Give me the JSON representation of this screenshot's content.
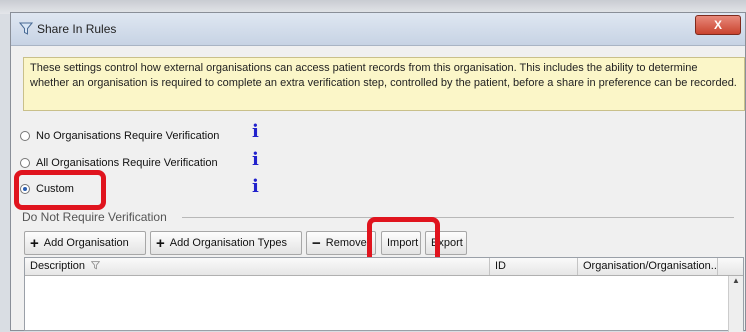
{
  "window": {
    "title": "Share In Rules",
    "close_label": "X"
  },
  "info_text": "These settings control how external organisations can access patient records from this organisation. This includes the ability to determine whether an organisation is required to complete an extra verification step, controlled by the patient, before a share in preference can be recorded.",
  "options": [
    {
      "label": "No Organisations Require Verification",
      "checked": false
    },
    {
      "label": "All Organisations Require Verification",
      "checked": false
    },
    {
      "label": "Custom",
      "checked": true
    }
  ],
  "group_label": "Do Not Require Verification",
  "toolbar": {
    "add_org": "Add Organisation",
    "add_org_types": "Add Organisation Types",
    "remove": "Remove",
    "import": "Import",
    "export": "Export"
  },
  "table": {
    "columns": [
      "Description",
      "ID",
      "Organisation/Organisation..."
    ]
  },
  "colors": {
    "highlight": "#e0141e",
    "info_bg": "#fbf6c8",
    "info_icon": "#2222cc"
  }
}
